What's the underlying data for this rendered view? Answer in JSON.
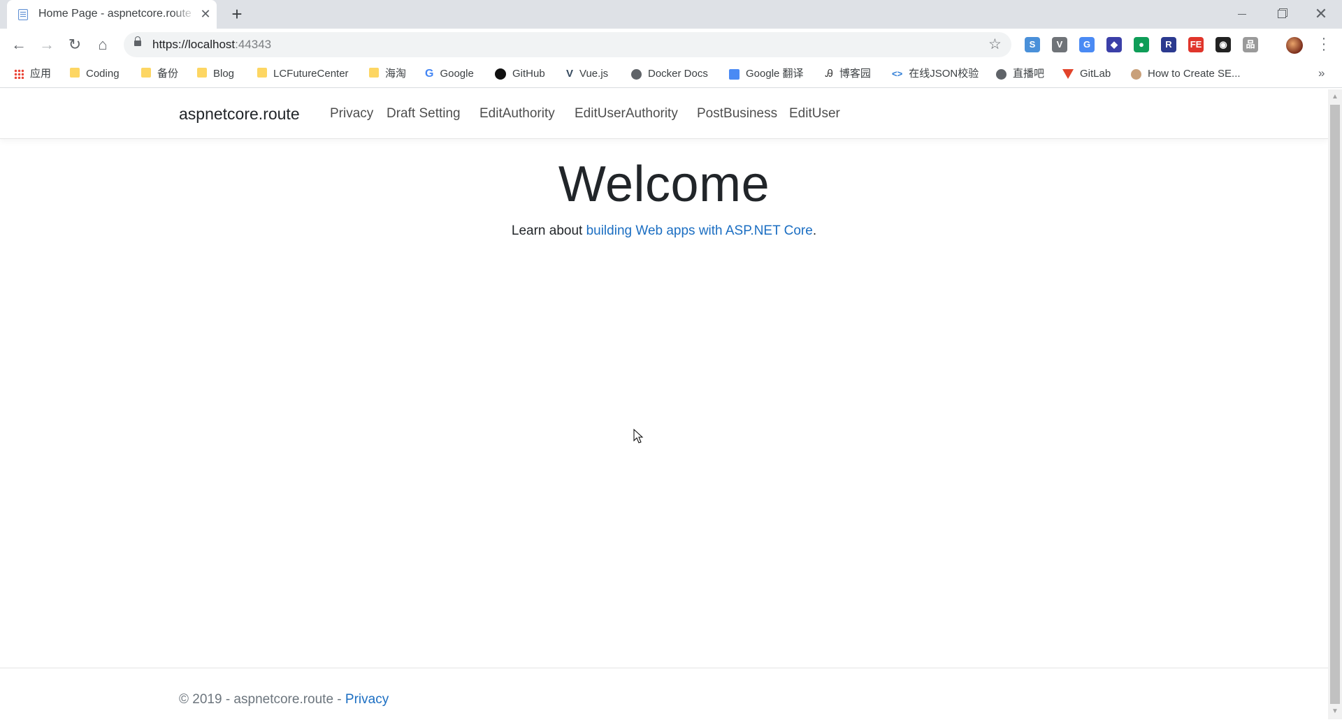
{
  "browser": {
    "tab": {
      "title": "Home Page - aspnetcore.route",
      "close": "✕"
    },
    "new_tab": "+",
    "window": {
      "close": "✕"
    },
    "nav": {
      "back": "←",
      "forward": "→",
      "reload": "↻",
      "home": "⌂"
    },
    "address": {
      "scheme_host": "https://localhost",
      "port": ":44343"
    },
    "star": "☆",
    "extensions": [
      {
        "icon": "sync-icon",
        "text": "S",
        "color": "#4a90d9"
      },
      {
        "icon": "vue-devtools-icon",
        "text": "V",
        "color": "#6f7378"
      },
      {
        "icon": "google-translate-icon",
        "text": "G",
        "color": "#4a8af4"
      },
      {
        "icon": "diamond-extension-icon",
        "text": "◆",
        "color": "#3b3fa8"
      },
      {
        "icon": "green-circle-icon",
        "text": "●",
        "color": "#0f9d58"
      },
      {
        "icon": "r-extension-icon",
        "text": "R",
        "color": "#2b3a8f"
      },
      {
        "icon": "fe-extension-icon",
        "text": "FE",
        "color": "#e0352b"
      },
      {
        "icon": "spy-extension-icon",
        "text": "◉",
        "color": "#222222"
      },
      {
        "icon": "tree-extension-icon",
        "text": "品",
        "color": "#9a9a9a"
      }
    ],
    "bookmarks": [
      {
        "label": "应用",
        "icon": "apps-grid-icon"
      },
      {
        "label": "Coding",
        "icon": "folder-icon"
      },
      {
        "label": "备份",
        "icon": "folder-icon"
      },
      {
        "label": "Blog",
        "icon": "folder-icon"
      },
      {
        "label": "LCFutureCenter",
        "icon": "folder-icon"
      },
      {
        "label": "海淘",
        "icon": "folder-icon"
      },
      {
        "label": "Google",
        "icon": "google-icon"
      },
      {
        "label": "GitHub",
        "icon": "github-icon"
      },
      {
        "label": "Vue.js",
        "icon": "vue-icon"
      },
      {
        "label": "Docker Docs",
        "icon": "globe-icon"
      },
      {
        "label": "Google 翻译",
        "icon": "google-translate-icon"
      },
      {
        "label": "博客园",
        "icon": "cnblogs-icon"
      },
      {
        "label": "在线JSON校验",
        "icon": "json-icon"
      },
      {
        "label": "直播吧",
        "icon": "globe-icon"
      },
      {
        "label": "GitLab",
        "icon": "gitlab-icon"
      },
      {
        "label": "How to Create SE...",
        "icon": "avatar-icon"
      }
    ],
    "bookmarks_more": "»"
  },
  "site": {
    "brand": "aspnetcore.route",
    "nav": [
      "Privacy",
      "Draft Setting",
      "EditAuthority",
      "EditUserAuthority",
      "PostBusiness",
      "EditUser"
    ],
    "hero": {
      "title": "Welcome",
      "text_before": "Learn about ",
      "link": "building Web apps with ASP.NET Core",
      "text_after": "."
    },
    "footer": {
      "text": "© 2019 - aspnetcore.route - ",
      "link": "Privacy"
    }
  },
  "colors": {
    "link": "#1b6ec2",
    "tabstrip": "#dee1e6",
    "omnibox": "#f1f3f4"
  }
}
